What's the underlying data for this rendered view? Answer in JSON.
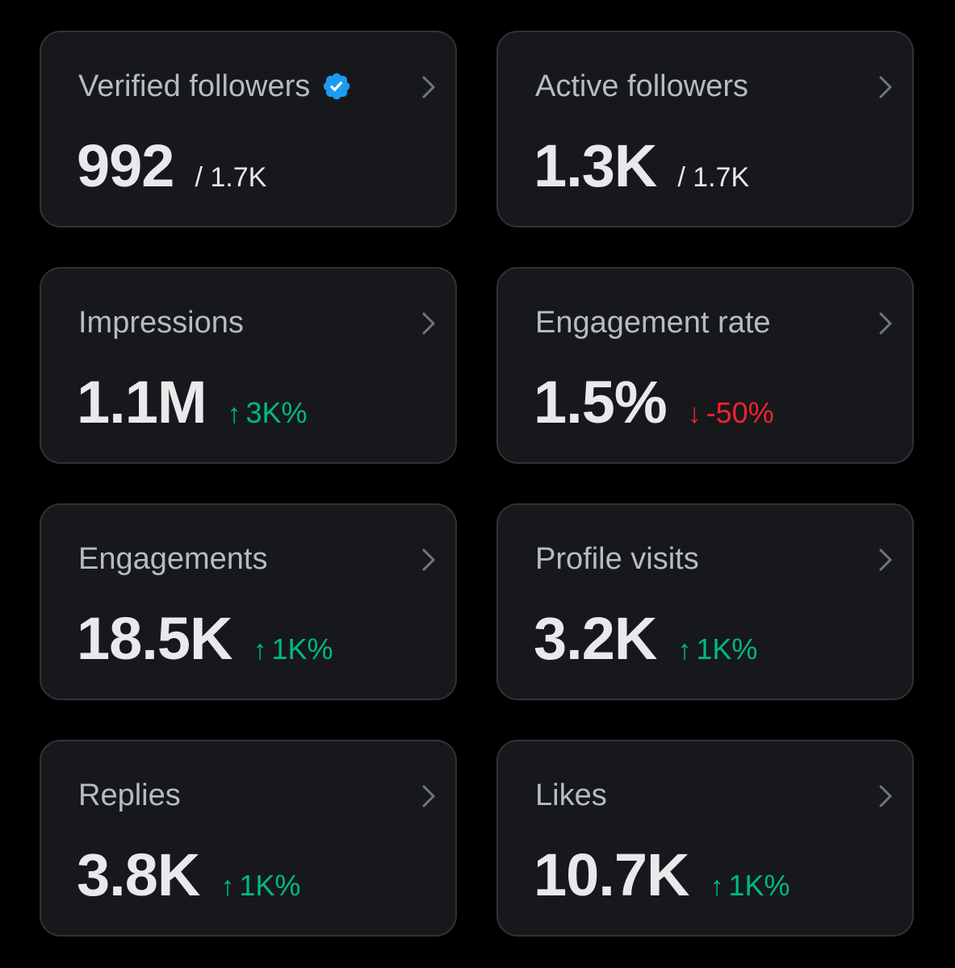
{
  "colors": {
    "background": "#000000",
    "card_background": "#16181c",
    "card_border": "#2f3336",
    "title_text": "#b7bcc1",
    "value_text": "#e7e9ea",
    "positive": "#00ba7c",
    "negative": "#f4212e",
    "verified_badge": "#1d9bf0"
  },
  "cards": [
    {
      "title": "Verified followers",
      "icon": "verified-badge-icon",
      "value": "992",
      "total": "/ 1.7K",
      "action_icon": "chevron-right-icon"
    },
    {
      "title": "Active followers",
      "value": "1.3K",
      "total": "/ 1.7K",
      "action_icon": "chevron-right-icon"
    },
    {
      "title": "Impressions",
      "value": "1.1M",
      "change": "3K%",
      "change_direction": "up",
      "change_arrow": "↑",
      "action_icon": "chevron-right-icon"
    },
    {
      "title": "Engagement rate",
      "value": "1.5%",
      "change": "-50%",
      "change_direction": "down",
      "change_arrow": "↓",
      "action_icon": "chevron-right-icon"
    },
    {
      "title": "Engagements",
      "value": "18.5K",
      "change": "1K%",
      "change_direction": "up",
      "change_arrow": "↑",
      "action_icon": "chevron-right-icon"
    },
    {
      "title": "Profile visits",
      "value": "3.2K",
      "change": "1K%",
      "change_direction": "up",
      "change_arrow": "↑",
      "action_icon": "chevron-right-icon"
    },
    {
      "title": "Replies",
      "value": "3.8K",
      "change": "1K%",
      "change_direction": "up",
      "change_arrow": "↑",
      "action_icon": "chevron-right-icon"
    },
    {
      "title": "Likes",
      "value": "10.7K",
      "change": "1K%",
      "change_direction": "up",
      "change_arrow": "↑",
      "action_icon": "chevron-right-icon"
    }
  ]
}
